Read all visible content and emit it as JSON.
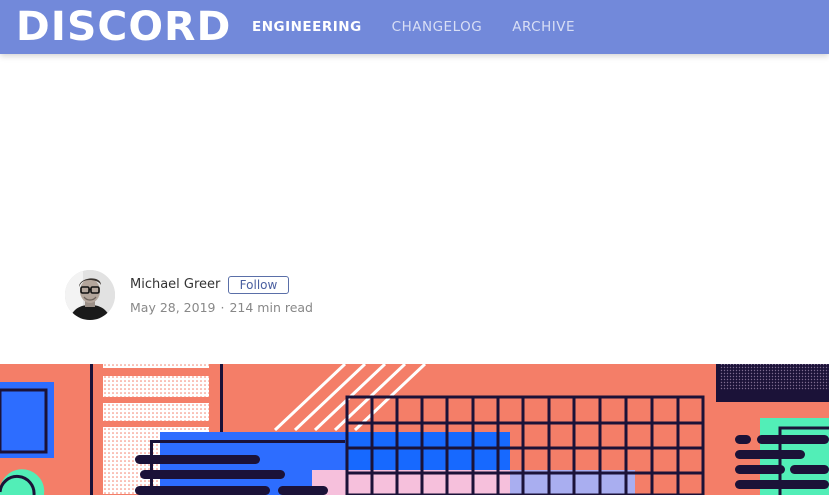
{
  "header": {
    "logo_text": "DISCORD",
    "nav": [
      {
        "label": "ENGINEERING",
        "active": true
      },
      {
        "label": "CHANGELOG",
        "active": false
      },
      {
        "label": "ARCHIVE",
        "active": false
      }
    ],
    "background_color": "#7289da"
  },
  "author": {
    "name": "Michael Greer",
    "follow_label": "Follow",
    "date": "May 28, 2019",
    "separator": "·",
    "read_time": "214 min read",
    "avatar_icon": "author-avatar-photo"
  },
  "hero": {
    "colors": {
      "salmon": "#f47e68",
      "navy": "#1b1238",
      "blue": "#1769ff",
      "pink": "#f6c0dc",
      "lavender": "#a9aef0",
      "mint": "#52eeb7"
    }
  }
}
